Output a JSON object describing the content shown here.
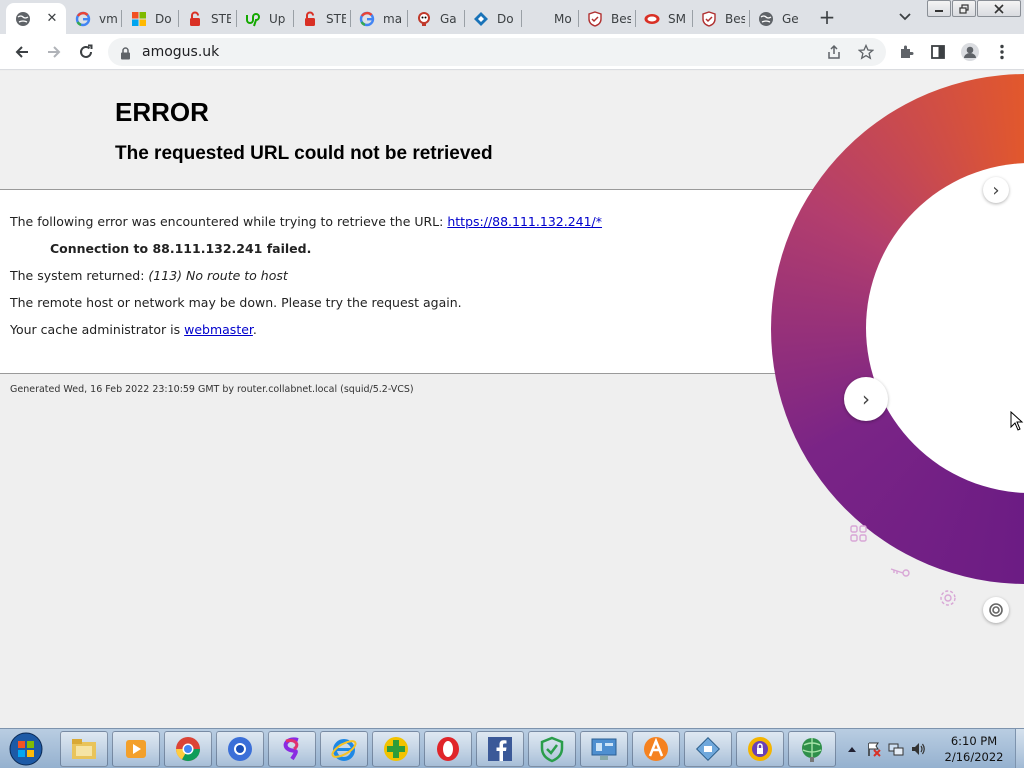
{
  "browser": {
    "active_tab_close": "✕",
    "tabs": [
      {
        "title": "vm",
        "icon": "google-icon"
      },
      {
        "title": "Do",
        "icon": "microsoft-icon"
      },
      {
        "title": "STE",
        "icon": "lock-red-icon"
      },
      {
        "title": "Up",
        "icon": "upwork-icon"
      },
      {
        "title": "STE",
        "icon": "lock-red-icon"
      },
      {
        "title": "ma",
        "icon": "google-icon"
      },
      {
        "title": "Ga",
        "icon": "skull-icon"
      },
      {
        "title": "Do",
        "icon": "diamond-icon"
      },
      {
        "title": "Mo",
        "icon": "blank"
      },
      {
        "title": "Bes",
        "icon": "shield-icon"
      },
      {
        "title": "SM",
        "icon": "red-oval-icon"
      },
      {
        "title": "Bes",
        "icon": "shield-icon"
      },
      {
        "title": "Ge",
        "icon": "globe-icon"
      }
    ],
    "new_tab": "+",
    "url": "amogus.uk"
  },
  "page": {
    "title": "ERROR",
    "subtitle": "The requested URL could not be retrieved",
    "line1_prefix": "The following error was encountered while trying to retrieve the URL: ",
    "line1_link": "https://88.111.132.241/*",
    "line2": "Connection to 88.111.132.241 failed.",
    "line3_prefix": "The system returned: ",
    "line3_value": "(113) No route to host",
    "line4": "The remote host or network may be down. Please try the request again.",
    "line5_prefix": "Your cache administrator is ",
    "line5_link": "webmaster",
    "line5_suffix": ".",
    "footer": "Generated Wed, 16 Feb 2022 23:10:59 GMT by router.collabnet.local (squid/5.2-VCS)"
  },
  "overlay": {
    "top_chevron": "›",
    "mid_chevron": "›"
  },
  "taskbar": {
    "apps": [
      "explorer-icon",
      "media-player-icon",
      "chrome-icon",
      "chrome-blue-icon",
      "swirl-icon",
      "ie-icon",
      "plus-app-icon",
      "opera-icon",
      "facebook-icon",
      "shield-check-icon",
      "control-panel-icon",
      "avast-icon",
      "network-icon",
      "vpn-icon",
      "globe-app-icon"
    ],
    "time": "6:10 PM",
    "date": "2/16/2022"
  },
  "colors": {
    "ring_start": "#e2582c",
    "ring_mid": "#8a2a8a",
    "link": "#0000cc"
  }
}
